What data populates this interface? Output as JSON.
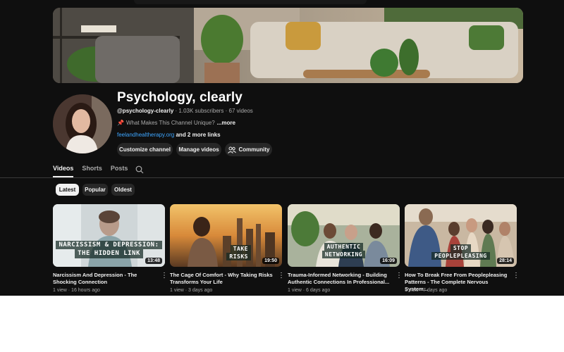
{
  "channel": {
    "name": "Psychology, clearly",
    "handle": "@psychology-clearly",
    "subscribers": "· 1.03K subscribers",
    "videos_count": "· 67 videos",
    "description": "What Makes This Channel Unique?",
    "more_label": "...more",
    "link": "feelandhealtherapy.org",
    "more_links": "and 2 more links"
  },
  "buttons": {
    "customize": "Customize channel",
    "manage": "Manage videos",
    "community": "Community"
  },
  "tabs": [
    {
      "label": "Videos",
      "active": true
    },
    {
      "label": "Shorts",
      "active": false
    },
    {
      "label": "Posts",
      "active": false
    }
  ],
  "chips": [
    {
      "label": "Latest",
      "selected": true
    },
    {
      "label": "Popular",
      "selected": false
    },
    {
      "label": "Oldest",
      "selected": false
    }
  ],
  "videos": [
    {
      "title": "Narcissism And Depression - The Shocking Connection",
      "meta": "1 view · 16 hours ago",
      "duration": "13:48",
      "overlay": [
        "NARCISSISM & DEPRESSION:",
        "THE HIDDEN LINK"
      ]
    },
    {
      "title": "The Cage Of Comfort - Why Taking Risks Transforms Your Life",
      "meta": "1 view · 3 days ago",
      "duration": "19:50",
      "overlay": [
        "TAKE",
        "RISKS"
      ]
    },
    {
      "title": "Trauma-Informed Networking - Building Authentic Connections In Professional...",
      "meta": "1 view · 6 days ago",
      "duration": "16:09",
      "overlay": [
        "AUTHENTIC",
        "NETWORKING"
      ]
    },
    {
      "title": "How To Break Free From Peoplepleasing Patterns - The Complete Nervous System...",
      "meta": "1 view · 7 days ago",
      "duration": "28:14",
      "overlay": [
        "STOP",
        "PEOPLEPLEASING"
      ]
    }
  ],
  "icons": {
    "pin": "pin-icon",
    "community": "people-icon",
    "search": "search-icon",
    "more": "more-vertical-icon"
  },
  "colors": {
    "background": "#0f0f0f",
    "link": "#3ea6ff",
    "button": "#272727",
    "text_secondary": "#aaaaaa"
  }
}
